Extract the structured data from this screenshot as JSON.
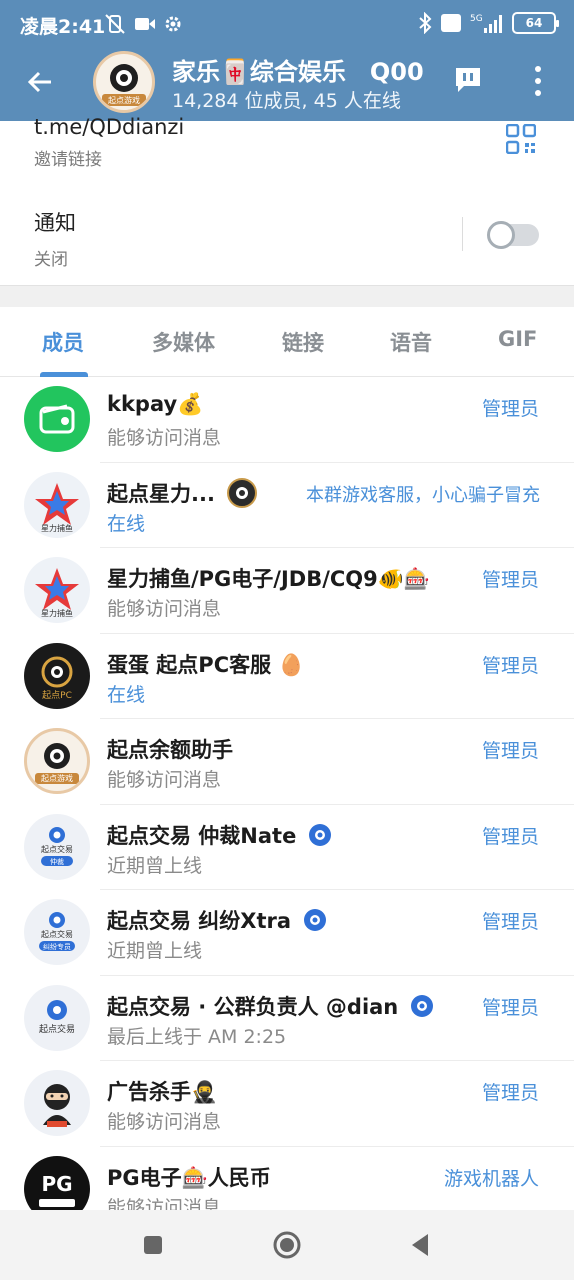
{
  "status_bar": {
    "time": "凌晨2:41",
    "battery": "64",
    "network": "5G"
  },
  "header": {
    "title": "家乐🀄综合娱乐　Q00",
    "subtitle": "14,284 位成员, 45 人在线"
  },
  "info": {
    "link": "t.me/QDdianzi",
    "link_label": "邀请链接",
    "notify_title": "通知",
    "notify_value": "关闭"
  },
  "tabs": [
    "成员",
    "多媒体",
    "链接",
    "语音",
    "GIF"
  ],
  "members": [
    {
      "name": "kkpay💰",
      "status": "能够访问消息",
      "role": "管理员",
      "online": false,
      "avatar_color": "#22c55e"
    },
    {
      "name": "起点星力...",
      "status": "在线",
      "role": "本群游戏客服，小心骗子冒充",
      "online": true,
      "avatar_color": "#eef2f7"
    },
    {
      "name": "星力捕鱼/PG电子/JDB/CQ9🐠🎰",
      "status": "能够访问消息",
      "role": "管理员",
      "online": false,
      "avatar_color": "#eef2f7"
    },
    {
      "name": "蛋蛋 起点PC客服 🥚",
      "status": "在线",
      "role": "管理员",
      "online": true,
      "avatar_color": "#1a1a1a"
    },
    {
      "name": "起点余额助手",
      "status": "能够访问消息",
      "role": "管理员",
      "online": false,
      "avatar_color": "#f7f1e8"
    },
    {
      "name": "起点交易 仲裁Nate",
      "status": "近期曾上线",
      "role": "管理员",
      "online": false,
      "avatar_color": "#eef1f6"
    },
    {
      "name": "起点交易 纠纷Xtra",
      "status": "近期曾上线",
      "role": "管理员",
      "online": false,
      "avatar_color": "#eef1f6"
    },
    {
      "name": "起点交易 · 公群负责人 @dian",
      "status": "最后上线于 AM 2:25",
      "role": "管理员",
      "online": false,
      "avatar_color": "#eef1f6"
    },
    {
      "name": "广告杀手🥷",
      "status": "能够访问消息",
      "role": "管理员",
      "online": false,
      "avatar_color": "#eef1f6"
    },
    {
      "name": "PG电子🎰人民币",
      "status": "能够访问消息",
      "role": "游戏机器人",
      "online": false,
      "avatar_color": "#111111"
    }
  ],
  "avatar_labels": {
    "m1": "星力捕鱼",
    "m2": "星力捕鱼",
    "m3": "起点PC",
    "m4": "起点游戏",
    "m5_top": "起点交易",
    "m5_bottom": "仲裁",
    "m6_top": "起点交易",
    "m6_bottom": "纠纷专员",
    "m7": "起点交易",
    "m9": "PG",
    "header": "起点游戏"
  },
  "colors": {
    "header_bg": "#5b8db9",
    "accent": "#4a90d9"
  }
}
